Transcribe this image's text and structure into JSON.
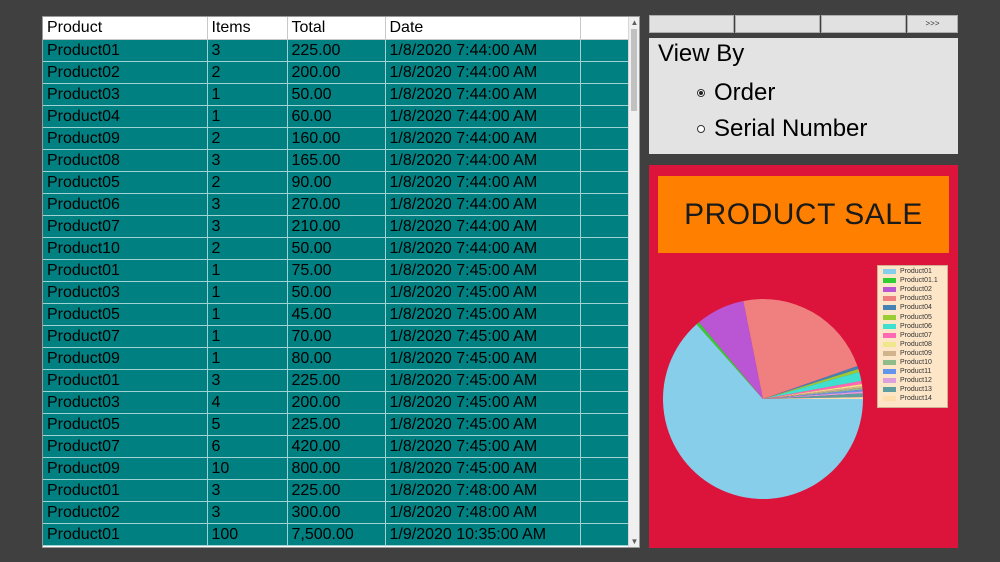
{
  "grid": {
    "columns": [
      "Product",
      "Items",
      "Total",
      "Date"
    ],
    "rows": [
      [
        "Product01",
        "3",
        "225.00",
        "1/8/2020 7:44:00 AM"
      ],
      [
        "Product02",
        "2",
        "200.00",
        "1/8/2020 7:44:00 AM"
      ],
      [
        "Product03",
        "1",
        "50.00",
        "1/8/2020 7:44:00 AM"
      ],
      [
        "Product04",
        "1",
        "60.00",
        "1/8/2020 7:44:00 AM"
      ],
      [
        "Product09",
        "2",
        "160.00",
        "1/8/2020 7:44:00 AM"
      ],
      [
        "Product08",
        "3",
        "165.00",
        "1/8/2020 7:44:00 AM"
      ],
      [
        "Product05",
        "2",
        "90.00",
        "1/8/2020 7:44:00 AM"
      ],
      [
        "Product06",
        "3",
        "270.00",
        "1/8/2020 7:44:00 AM"
      ],
      [
        "Product07",
        "3",
        "210.00",
        "1/8/2020 7:44:00 AM"
      ],
      [
        "Product10",
        "2",
        "50.00",
        "1/8/2020 7:44:00 AM"
      ],
      [
        "Product01",
        "1",
        "75.00",
        "1/8/2020 7:45:00 AM"
      ],
      [
        "Product03",
        "1",
        "50.00",
        "1/8/2020 7:45:00 AM"
      ],
      [
        "Product05",
        "1",
        "45.00",
        "1/8/2020 7:45:00 AM"
      ],
      [
        "Product07",
        "1",
        "70.00",
        "1/8/2020 7:45:00 AM"
      ],
      [
        "Product09",
        "1",
        "80.00",
        "1/8/2020 7:45:00 AM"
      ],
      [
        "Product01",
        "3",
        "225.00",
        "1/8/2020 7:45:00 AM"
      ],
      [
        "Product03",
        "4",
        "200.00",
        "1/8/2020 7:45:00 AM"
      ],
      [
        "Product05",
        "5",
        "225.00",
        "1/8/2020 7:45:00 AM"
      ],
      [
        "Product07",
        "6",
        "420.00",
        "1/8/2020 7:45:00 AM"
      ],
      [
        "Product09",
        "10",
        "800.00",
        "1/8/2020 7:45:00 AM"
      ],
      [
        "Product01",
        "3",
        "225.00",
        "1/8/2020 7:48:00 AM"
      ],
      [
        "Product02",
        "3",
        "300.00",
        "1/8/2020 7:48:00 AM"
      ],
      [
        "Product01",
        "100",
        "7,500.00",
        "1/9/2020 10:35:00 AM"
      ]
    ]
  },
  "toolbar": {
    "buttons": [
      "",
      "",
      "",
      ">>>"
    ]
  },
  "view_by": {
    "title": "View By",
    "options": [
      "Order",
      "Serial Number"
    ],
    "selected": "Order"
  },
  "chart_panel": {
    "background": "#dc143c",
    "title_background": "#ff8000"
  },
  "chart_data": {
    "type": "pie",
    "title": "PRODUCT SALE",
    "legend_position": "right",
    "slices": [
      {
        "name": "Product01",
        "value": 64,
        "color": "#87ceeb"
      },
      {
        "name": "Product01.1",
        "value": 0.5,
        "color": "#32cd32"
      },
      {
        "name": "Product02",
        "value": 8,
        "color": "#ba55d3"
      },
      {
        "name": "Product03",
        "value": 23,
        "color": "#f08080"
      },
      {
        "name": "Product04",
        "value": 0.5,
        "color": "#4682b4"
      },
      {
        "name": "Product05",
        "value": 0.5,
        "color": "#9acd32"
      },
      {
        "name": "Product06",
        "value": 1.5,
        "color": "#40e0d0"
      },
      {
        "name": "Product07",
        "value": 0.5,
        "color": "#ff69b4"
      },
      {
        "name": "Product08",
        "value": 0.3,
        "color": "#f0e68c"
      },
      {
        "name": "Product09",
        "value": 0.3,
        "color": "#d2b48c"
      },
      {
        "name": "Product10",
        "value": 0.3,
        "color": "#8fbc8b"
      },
      {
        "name": "Product11",
        "value": 0.3,
        "color": "#6495ed"
      },
      {
        "name": "Product12",
        "value": 0.3,
        "color": "#dda0dd"
      },
      {
        "name": "Product13",
        "value": 0.6,
        "color": "#5f9ea0"
      },
      {
        "name": "Product14",
        "value": 0.3,
        "color": "#ffdead"
      }
    ]
  }
}
